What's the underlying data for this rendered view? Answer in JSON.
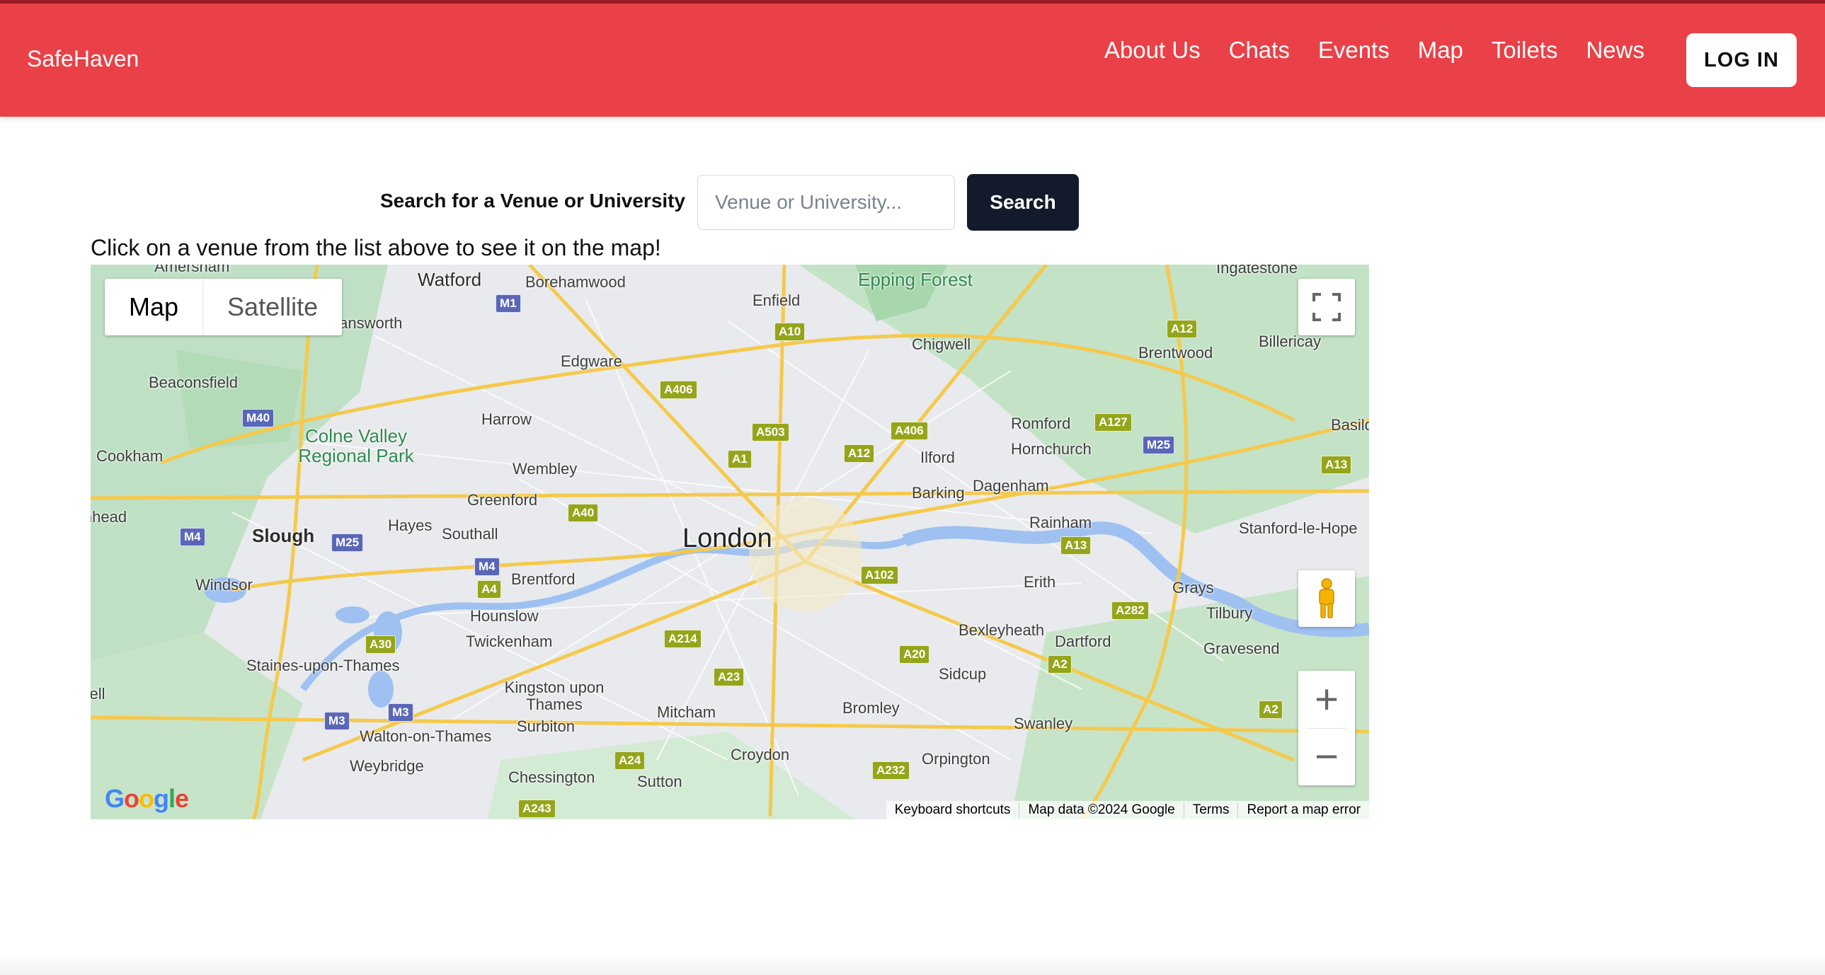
{
  "nav": {
    "brand": "SafeHaven",
    "links": [
      "About Us",
      "Chats",
      "Events",
      "Map",
      "Toilets",
      "News"
    ],
    "login": "LOG IN"
  },
  "search": {
    "label": "Search for a Venue or University",
    "placeholder": "Venue or University...",
    "button": "Search"
  },
  "instruction": "Click on a venue from the list above to see it on the map!",
  "map": {
    "type_controls": [
      "Map",
      "Satellite"
    ],
    "active_type": "Map",
    "city": "London",
    "places": [
      "Amersham",
      "Watford",
      "Borehamwood",
      "Enfield",
      "Epping Forest",
      "Ingatestone",
      "Rickmansworth",
      "Chigwell",
      "Brentwood",
      "Billericay",
      "Edgware",
      "Beaconsfield",
      "Harrow",
      "Romford",
      "Hornchurch",
      "Colne Valley Regional Park",
      "Cookham",
      "Wembley",
      "Ilford",
      "Dagenham",
      "Barking",
      "Basildon",
      "Maidenhead",
      "Slough",
      "Hayes",
      "Greenford",
      "Southall",
      "Rainham",
      "Stanford-le-Hope",
      "Brentford",
      "Erith",
      "Windsor",
      "Hounslow",
      "Grays",
      "Tilbury",
      "Twickenham",
      "Bexleyheath",
      "Dartford",
      "Gravesend",
      "Staines-upon-Thames",
      "Kingston upon Thames",
      "Sidcup",
      "Mitcham",
      "Bromley",
      "Surbiton",
      "Walton-on-Thames",
      "Swanley",
      "Weybridge",
      "Croydon",
      "Orpington",
      "Chessington",
      "Sutton",
      "Bracknell"
    ],
    "road_labels": [
      "M1",
      "A10",
      "A12",
      "A406",
      "A127",
      "A503",
      "A1",
      "A406",
      "A12",
      "M25",
      "A13",
      "M40",
      "A40",
      "M4",
      "M25",
      "A13",
      "M4",
      "A102",
      "A282",
      "A4",
      "A214",
      "A30",
      "A20",
      "A23",
      "A2",
      "M3",
      "A2",
      "A24",
      "A232",
      "A243",
      "M3"
    ],
    "attribution": [
      "Keyboard shortcuts",
      "Map data ©2024 Google",
      "Terms",
      "Report a map error"
    ],
    "logo": "Google"
  },
  "colors": {
    "navbar": "#ea4047",
    "search_button": "#121a2c",
    "water": "#9ec1f2",
    "parks": "#a8d8a8",
    "roads": "#f5c94c"
  },
  "icons": {
    "fullscreen": "fullscreen-icon",
    "pegman": "pegman-icon",
    "zoom_in": "zoom-in-icon",
    "zoom_out": "zoom-out-icon"
  }
}
